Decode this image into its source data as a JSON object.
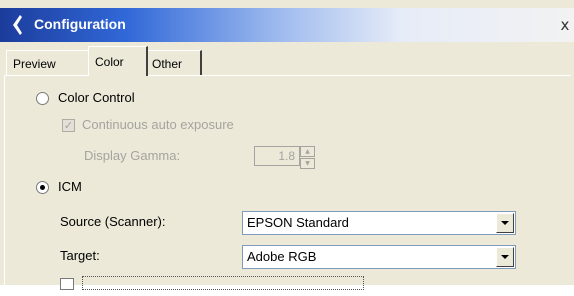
{
  "window": {
    "title": "Configuration",
    "close_glyph": "x"
  },
  "tabs": [
    {
      "label": "Preview",
      "active": false
    },
    {
      "label": "Color",
      "active": true
    },
    {
      "label": "Other",
      "active": false
    }
  ],
  "color_control": {
    "label": "Color Control",
    "selected": false
  },
  "continuous_auto_exposure": {
    "label": "Continuous auto exposure",
    "checked": true,
    "enabled": false
  },
  "display_gamma": {
    "label": "Display Gamma:",
    "value": "1.8",
    "enabled": false
  },
  "icm": {
    "label": "ICM",
    "selected": true
  },
  "source": {
    "label": "Source (Scanner):",
    "value": "EPSON Standard"
  },
  "target": {
    "label": "Target:",
    "value": "Adobe RGB"
  }
}
